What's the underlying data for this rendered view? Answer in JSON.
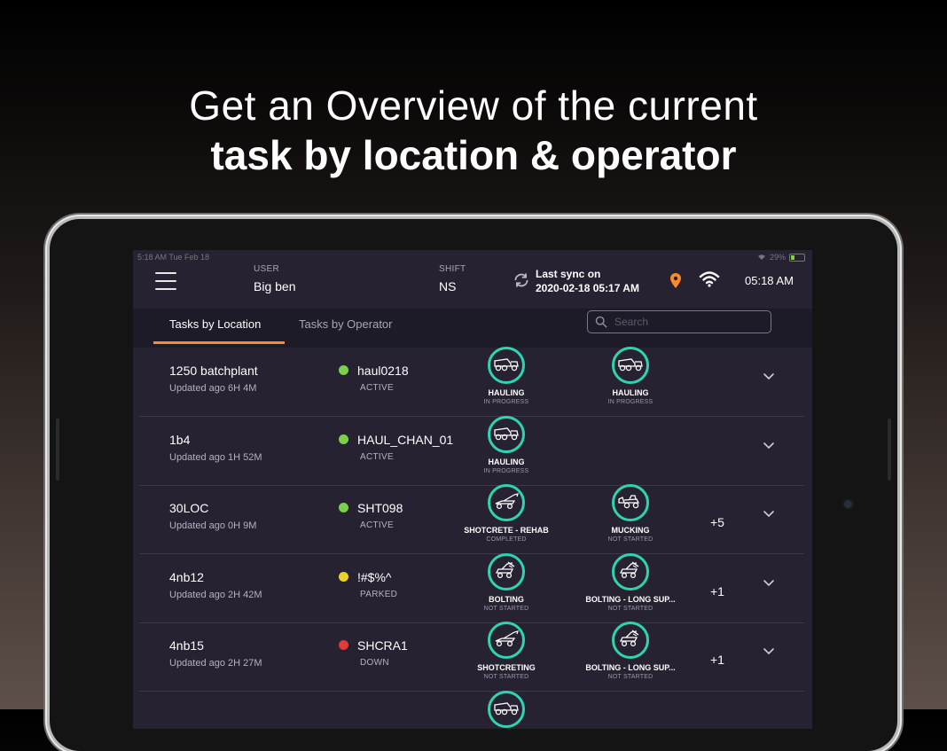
{
  "headline": {
    "line1": "Get an Overview of the current",
    "line2": "task by location & operator"
  },
  "statusbar": {
    "time": "5:18 AM   Tue Feb 18",
    "battery": "29%"
  },
  "appbar": {
    "user_label": "USER",
    "user_value": "Big ben",
    "shift_label": "SHIFT",
    "shift_value": "NS",
    "sync_label": "Last sync on",
    "sync_value": "2020-02-18 05:17 AM",
    "clock": "05:18 AM"
  },
  "tabs": {
    "location": "Tasks by Location",
    "operator": "Tasks by Operator"
  },
  "search": {
    "placeholder": "Search"
  },
  "colors": {
    "accent_orange": "#ff8a2b",
    "task_circle": "#2fd3b0",
    "status_active": "#7bd14b",
    "status_parked": "#e8d22c",
    "status_down": "#e03a3a",
    "screen_bg": "#262232"
  },
  "rows": [
    {
      "location": "1250 batchplant",
      "updated": "Updated ago 6H 4M",
      "equipment": "haul0218",
      "status": "ACTIVE",
      "status_color": "#7bd14b",
      "tasks": [
        {
          "name": "HAULING",
          "status": "IN PROGRESS",
          "icon": "haul-truck-icon"
        },
        {
          "name": "HAULING",
          "status": "IN PROGRESS",
          "icon": "haul-truck-icon"
        }
      ],
      "more": ""
    },
    {
      "location": "1b4",
      "updated": "Updated ago 1H 52M",
      "equipment": "HAUL_CHAN_01",
      "status": "ACTIVE",
      "status_color": "#7bd14b",
      "tasks": [
        {
          "name": "HAULING",
          "status": "IN PROGRESS",
          "icon": "haul-truck-icon"
        }
      ],
      "more": ""
    },
    {
      "location": "30LOC",
      "updated": "Updated ago 0H 9M",
      "equipment": "SHT098",
      "status": "ACTIVE",
      "status_color": "#7bd14b",
      "tasks": [
        {
          "name": "SHOTCRETE - REHAB",
          "status": "COMPLETED",
          "icon": "shotcrete-icon"
        },
        {
          "name": "MUCKING",
          "status": "NOT STARTED",
          "icon": "loader-icon"
        }
      ],
      "more": "+5"
    },
    {
      "location": "4nb12",
      "updated": "Updated ago 2H 42M",
      "equipment": "!#$%^",
      "status": "PARKED",
      "status_color": "#e8d22c",
      "tasks": [
        {
          "name": "BOLTING",
          "status": "NOT STARTED",
          "icon": "bolter-icon"
        },
        {
          "name": "BOLTING - LONG SUP...",
          "status": "NOT STARTED",
          "icon": "bolter-icon"
        }
      ],
      "more": "+1"
    },
    {
      "location": "4nb15",
      "updated": "Updated ago 2H 27M",
      "equipment": "SHCRA1",
      "status": "DOWN",
      "status_color": "#e03a3a",
      "tasks": [
        {
          "name": "SHOTCRETING",
          "status": "NOT STARTED",
          "icon": "shotcrete-icon"
        },
        {
          "name": "BOLTING - LONG SUP...",
          "status": "NOT STARTED",
          "icon": "bolter-icon"
        }
      ],
      "more": "+1"
    },
    {
      "location": "",
      "updated": "",
      "equipment": "",
      "status": "",
      "status_color": "",
      "tasks": [
        {
          "name": "",
          "status": "",
          "icon": "haul-truck-icon"
        }
      ],
      "more": ""
    }
  ]
}
